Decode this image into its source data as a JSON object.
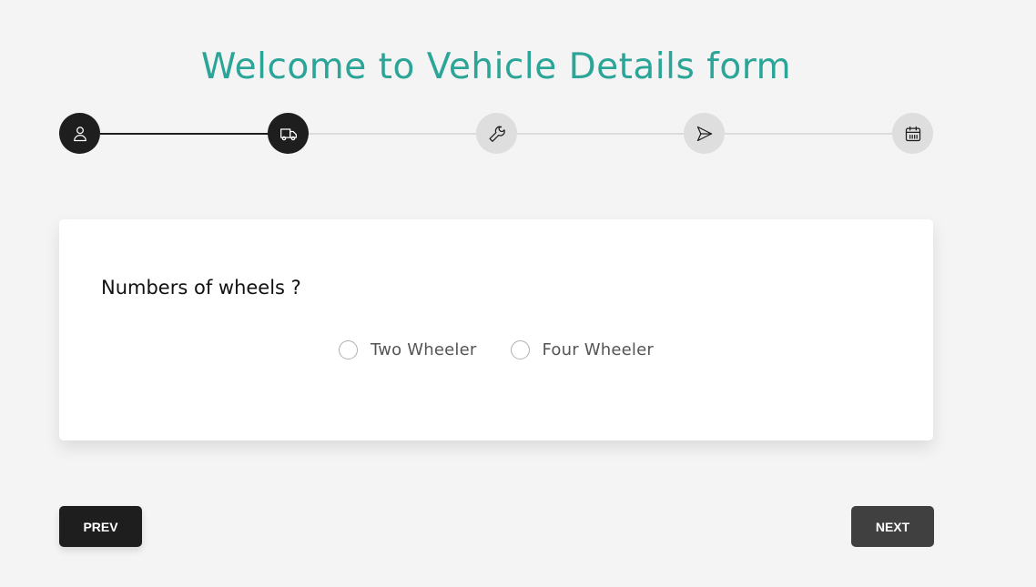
{
  "page_title": "Welcome to Vehicle Details form",
  "stepper": {
    "steps": [
      {
        "icon": "user-icon",
        "state": "completed"
      },
      {
        "icon": "truck-icon",
        "state": "active"
      },
      {
        "icon": "wrench-icon",
        "state": "pending"
      },
      {
        "icon": "send-icon",
        "state": "pending"
      },
      {
        "icon": "calendar-icon",
        "state": "pending"
      }
    ]
  },
  "card": {
    "question": "Numbers of wheels ?",
    "options": [
      {
        "label": "Two Wheeler",
        "selected": false
      },
      {
        "label": "Four Wheeler",
        "selected": false
      }
    ]
  },
  "buttons": {
    "prev_label": "PREV",
    "next_label": "NEXT"
  },
  "colors": {
    "accent": "#2aa597",
    "active_step": "#1e1e1e",
    "inactive_step": "#dedede",
    "background": "#f4f4f4"
  }
}
